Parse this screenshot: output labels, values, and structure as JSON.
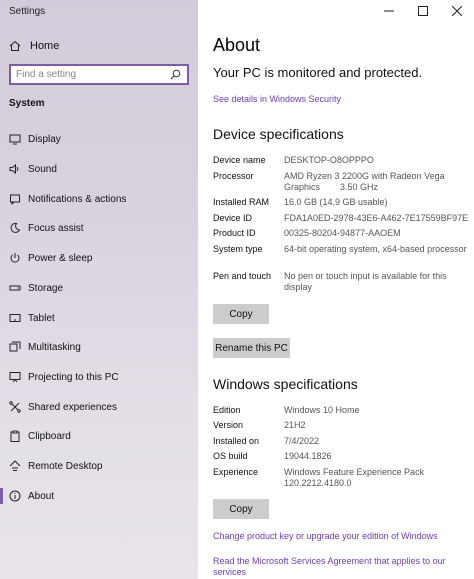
{
  "window": {
    "title": "Settings"
  },
  "sidebar": {
    "home_label": "Home",
    "search_placeholder": "Find a setting",
    "section_label": "System",
    "items": [
      {
        "label": "Display",
        "icon": "display-icon"
      },
      {
        "label": "Sound",
        "icon": "speaker-icon"
      },
      {
        "label": "Notifications & actions",
        "icon": "notification-icon"
      },
      {
        "label": "Focus assist",
        "icon": "moon-icon"
      },
      {
        "label": "Power & sleep",
        "icon": "power-icon"
      },
      {
        "label": "Storage",
        "icon": "storage-icon"
      },
      {
        "label": "Tablet",
        "icon": "tablet-icon"
      },
      {
        "label": "Multitasking",
        "icon": "multitasking-icon"
      },
      {
        "label": "Projecting to this PC",
        "icon": "projecting-icon"
      },
      {
        "label": "Shared experiences",
        "icon": "shared-icon"
      },
      {
        "label": "Clipboard",
        "icon": "clipboard-icon"
      },
      {
        "label": "Remote Desktop",
        "icon": "remote-desktop-icon"
      },
      {
        "label": "About",
        "icon": "info-icon",
        "active": true
      }
    ]
  },
  "main": {
    "title": "About",
    "protection_status": "Your PC is monitored and protected.",
    "security_link": "See details in Windows Security",
    "device_heading": "Device specifications",
    "device_specs": [
      {
        "label": "Device name",
        "value": "DESKTOP-O8OPPPO"
      },
      {
        "label": "Processor",
        "value": "AMD Ryzen 3 2200G with Radeon Vega Graphics        3.50 GHz"
      },
      {
        "label": "Installed RAM",
        "value": "16.0 GB (14.9 GB usable)"
      },
      {
        "label": "Device ID",
        "value": "FDA1A0ED-2978-43E6-A462-7E17559BF97E"
      },
      {
        "label": "Product ID",
        "value": "00325-80204-94877-AAOEM"
      },
      {
        "label": "System type",
        "value": "64-bit operating system, x64-based processor"
      },
      {
        "label": "Pen and touch",
        "value": "No pen or touch input is available for this display"
      }
    ],
    "copy_label": "Copy",
    "rename_label": "Rename this PC",
    "windows_heading": "Windows specifications",
    "windows_specs": [
      {
        "label": "Edition",
        "value": "Windows 10 Home"
      },
      {
        "label": "Version",
        "value": "21H2"
      },
      {
        "label": "Installed on",
        "value": "7/4/2022"
      },
      {
        "label": "OS build",
        "value": "19044.1826"
      },
      {
        "label": "Experience",
        "value": "Windows Feature Experience Pack 120.2212.4180.0"
      }
    ],
    "copy2_label": "Copy",
    "product_key_link": "Change product key or upgrade your edition of Windows",
    "services_link": "Read the Microsoft Services Agreement that applies to our services"
  },
  "colors": {
    "accent": "#7b5ea7",
    "link": "#6c3fb0",
    "button": "#cccccc"
  }
}
